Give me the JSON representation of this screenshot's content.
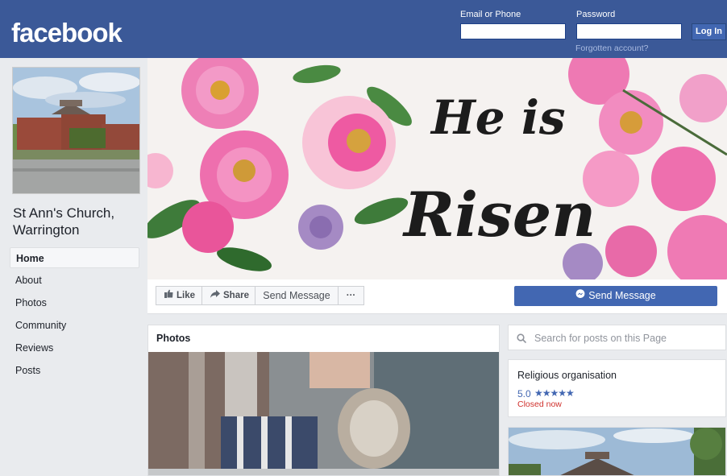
{
  "header": {
    "logo": "facebook",
    "email_label": "Email or Phone",
    "password_label": "Password",
    "login_button": "Log In",
    "forgot_link": "Forgotten account?"
  },
  "page": {
    "name_line1": "St Ann's Church,",
    "name_line2": "Warrington"
  },
  "nav": {
    "items": [
      {
        "label": "Home"
      },
      {
        "label": "About"
      },
      {
        "label": "Photos"
      },
      {
        "label": "Community"
      },
      {
        "label": "Reviews"
      },
      {
        "label": "Posts"
      }
    ]
  },
  "cover": {
    "line1": "He is",
    "line2": "Risen"
  },
  "actions": {
    "like": "Like",
    "share": "Share",
    "send_message": "Send Message",
    "more": "···",
    "primary": "Send Message"
  },
  "photos": {
    "title": "Photos"
  },
  "sidebar": {
    "search_placeholder": "Search for posts on this Page",
    "category": "Religious organisation",
    "rating": "5.0",
    "stars": "★★★★★",
    "status": "Closed now"
  },
  "colors": {
    "brand": "#3b5998",
    "button_primary": "#4267b2",
    "closed": "#d0312d"
  }
}
